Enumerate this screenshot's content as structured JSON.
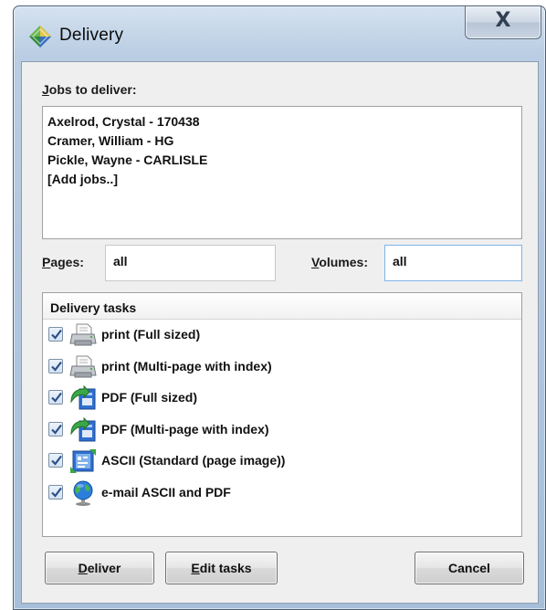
{
  "window": {
    "title": "Delivery",
    "close_symbol": "X"
  },
  "jobs": {
    "label_key": "J",
    "label_rest": "obs to deliver:",
    "items": [
      "Axelrod, Crystal - 170438",
      "Cramer, William - HG",
      "Pickle, Wayne - CARLISLE",
      "[Add jobs..]"
    ]
  },
  "pages": {
    "label_key": "P",
    "label_rest": "ages:",
    "value": "all"
  },
  "volumes": {
    "label_key": "V",
    "label_rest": "olumes:",
    "value": "all"
  },
  "tasks": {
    "header": "Delivery tasks",
    "items": [
      {
        "label": "print (Full sized)",
        "icon": "printer-icon",
        "checked": true
      },
      {
        "label": "print (Multi-page with index)",
        "icon": "printer-icon",
        "checked": true
      },
      {
        "label": "PDF (Full sized)",
        "icon": "pdf-export-icon",
        "checked": true
      },
      {
        "label": "PDF (Multi-page with index)",
        "icon": "pdf-export-icon",
        "checked": true
      },
      {
        "label": "ASCII (Standard (page image))",
        "icon": "ascii-export-icon",
        "checked": true
      },
      {
        "label": "e-mail ASCII and PDF",
        "icon": "globe-icon",
        "checked": true
      }
    ]
  },
  "buttons": {
    "deliver_key": "D",
    "deliver_rest": "eliver",
    "edit_key": "E",
    "edit_rest": "dit tasks",
    "cancel": "Cancel"
  },
  "colors": {
    "titlebar": "#b9cde3",
    "client_bg": "#efefef",
    "focus_border": "#7eb4ea"
  }
}
